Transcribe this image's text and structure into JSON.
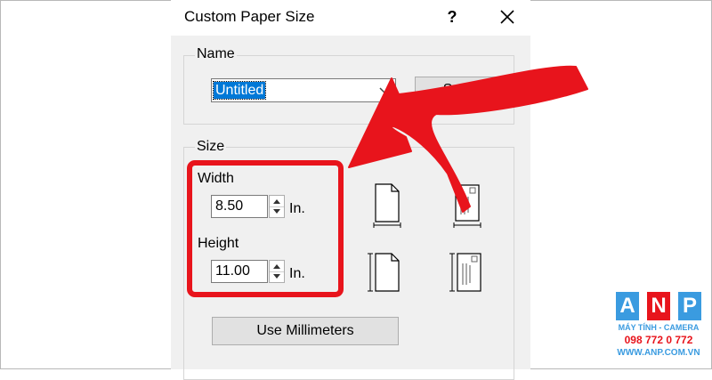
{
  "dialog": {
    "title": "Custom Paper Size",
    "help_label": "?",
    "close_icon": "close-icon"
  },
  "name_group": {
    "label": "Name",
    "combo_value": "Untitled",
    "save_label": "Save"
  },
  "size_group": {
    "label": "Size",
    "width_label": "Width",
    "width_value": "8.50",
    "width_unit": "In.",
    "height_label": "Height",
    "height_value": "11.00",
    "height_unit": "In.",
    "use_mm_label": "Use Millimeters",
    "icons": [
      "portrait-width-icon",
      "envelope-width-icon",
      "portrait-height-icon",
      "envelope-height-icon"
    ]
  },
  "annotation": {
    "color": "#e8141c"
  },
  "watermark": {
    "letters": [
      "A",
      "N",
      "P"
    ],
    "letter_colors": [
      "#3a9be0",
      "#e8141c",
      "#3a9be0"
    ],
    "tagline": "MÁY TÍNH - CAMERA",
    "phone": "098 772 0 772",
    "website": "WWW.ANP.COM.VN"
  }
}
